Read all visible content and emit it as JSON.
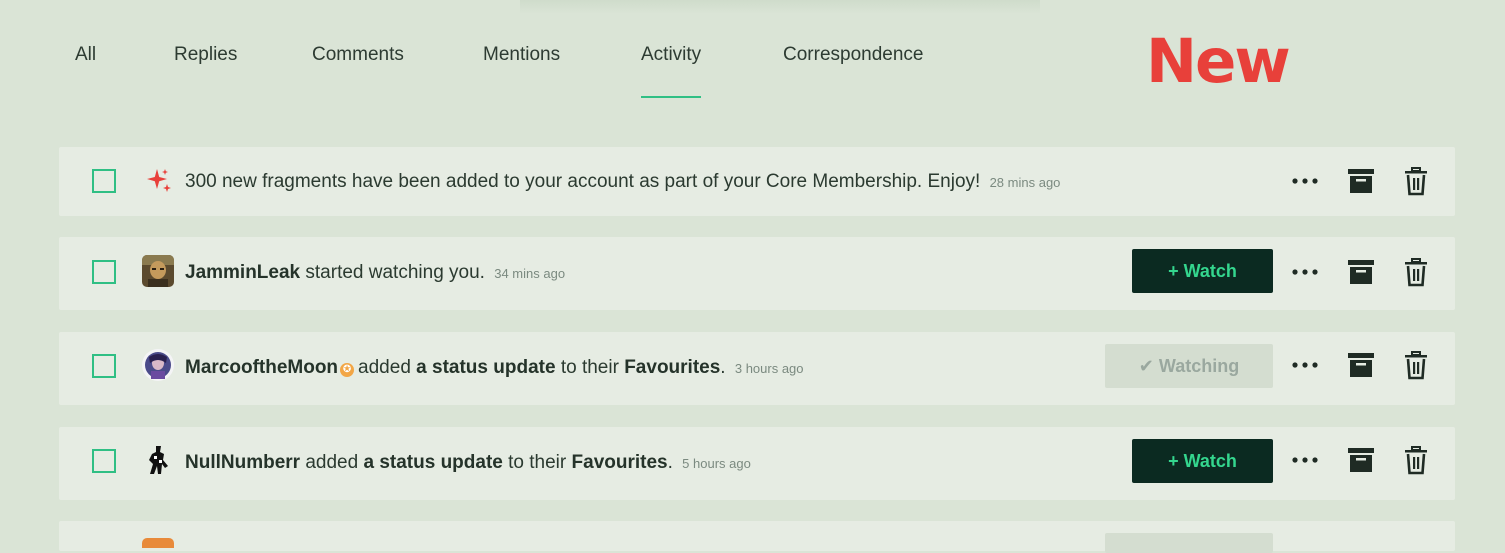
{
  "tabs": [
    {
      "label": "All"
    },
    {
      "label": "Replies"
    },
    {
      "label": "Comments"
    },
    {
      "label": "Mentions"
    },
    {
      "label": "Activity",
      "active": true
    },
    {
      "label": "Correspondence"
    }
  ],
  "badge": {
    "text": "New",
    "color": "#e8403a"
  },
  "colors": {
    "accent": "#2fbf84",
    "watch_bg": "#0b2a21",
    "watch_text": "#34d68e",
    "row_bg": "#e6ece3",
    "page_bg": "#dae4d6"
  },
  "buttons": {
    "watch": "+ Watch",
    "watching": "✔ Watching"
  },
  "notifications": [
    {
      "icon": "sparkle-icon",
      "text": "300 new fragments have been added to your account as part of your Core Membership. Enjoy!",
      "time": "28 mins ago"
    },
    {
      "user": "JamminLeak",
      "action": "started watching you.",
      "time": "34 mins ago",
      "button": "watch"
    },
    {
      "user": "MarcooftheMoon",
      "badge_icon": "core-member-badge-icon",
      "action_pre": "added",
      "object": "a status update",
      "action_mid": "to their",
      "target": "Favourites",
      "time": "3 hours ago",
      "button": "watching"
    },
    {
      "user": "NullNumberr",
      "action_pre": "added",
      "object": "a status update",
      "action_mid": "to their",
      "target": "Favourites",
      "time": "5 hours ago",
      "button": "watch"
    }
  ]
}
